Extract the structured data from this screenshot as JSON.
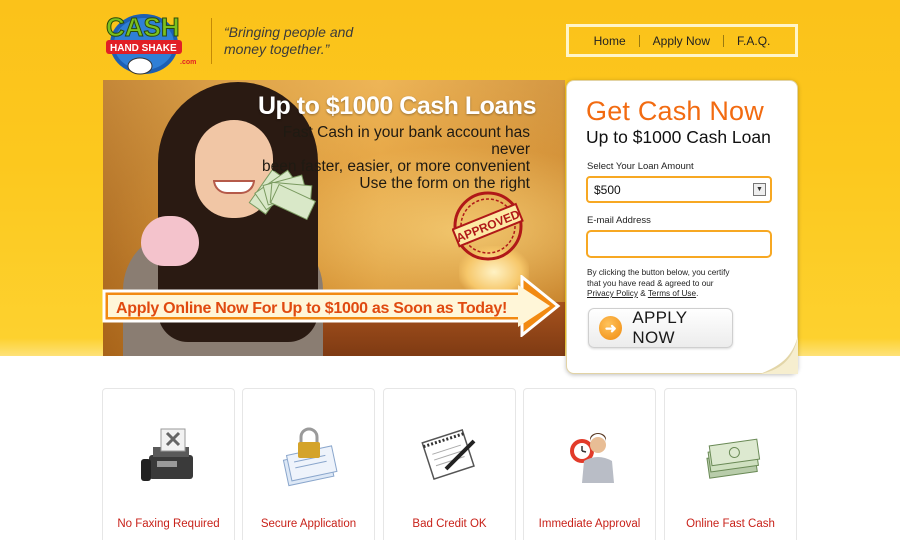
{
  "branding": {
    "logo_alt": "Cash Hand Shake .com",
    "tagline_line1": "“Bringing people and",
    "tagline_line2": "money together.”"
  },
  "nav": {
    "items": [
      "Home",
      "Apply Now",
      "F.A.Q."
    ]
  },
  "hero": {
    "title": "Up to $1000 Cash Loans",
    "sub_line1": "Fast Cash in your bank account has never",
    "sub_line2": "been faster, easier, or more convenient",
    "sub_line3": "Use the form on the right",
    "stamp_text": "APPROVED",
    "arrow_text": "Apply Online Now For Up to $1000 as Soon as Today!"
  },
  "form": {
    "title": "Get Cash Now",
    "subtitle": "Up to $1000 Cash Loan",
    "amount_label": "Select Your Loan Amount",
    "amount_value": "$500",
    "email_label": "E-mail Address",
    "email_value": "",
    "disclaimer_1": "By clicking the button below, you certify",
    "disclaimer_2": "that you have read & agreed to our",
    "privacy_link": "Privacy Policy",
    "amp": " & ",
    "terms_link": "Terms of Use",
    "period": ".",
    "button_label": "APPLY NOW"
  },
  "features": [
    {
      "label": "No Faxing Required",
      "icon": "no-fax-icon"
    },
    {
      "label": "Secure Application",
      "icon": "padlock-documents-icon"
    },
    {
      "label": "Bad Credit OK",
      "icon": "notepad-pen-icon"
    },
    {
      "label": "Immediate Approval",
      "icon": "alarm-clock-man-icon"
    },
    {
      "label": "Online Fast Cash",
      "icon": "cash-stack-icon"
    }
  ],
  "colors": {
    "accent_orange": "#f26b11",
    "band_yellow": "#fcc81e",
    "feature_red": "#c8221a"
  }
}
